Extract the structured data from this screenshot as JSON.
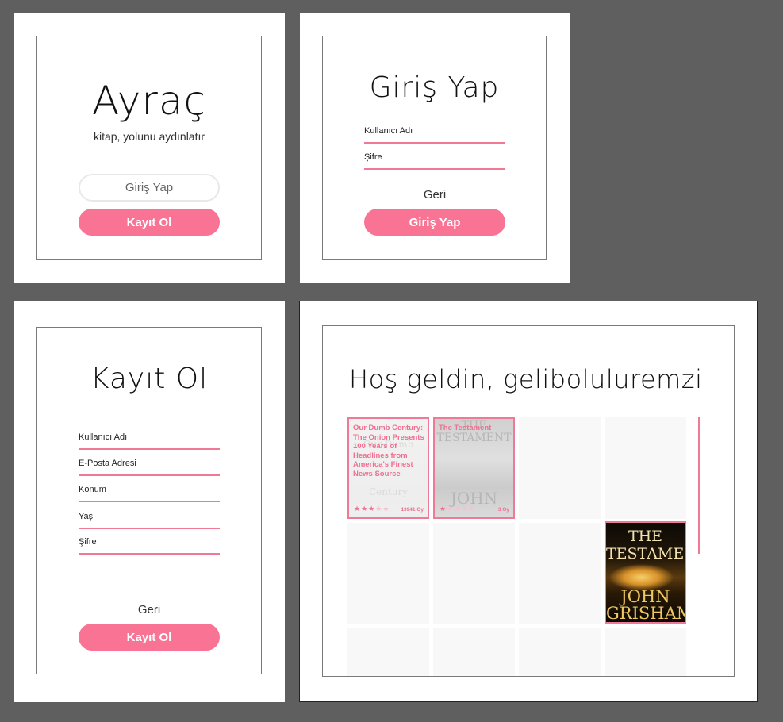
{
  "welcome": {
    "app_name": "Ayraç",
    "tagline": "kitap, yolunu aydınlatır",
    "login_label": "Giriş Yap",
    "register_label": "Kayıt Ol"
  },
  "login": {
    "title": "Giriş Yap",
    "username_label": "Kullanıcı Adı",
    "password_label": "Şifre",
    "back_label": "Geri",
    "submit_label": "Giriş Yap"
  },
  "register": {
    "title": "Kayıt Ol",
    "fields": [
      "Kullanıcı Adı",
      "E-Posta Adresi",
      "Konum",
      "Yaş",
      "Şifre"
    ],
    "back_label": "Geri",
    "submit_label": "Kayıt Ol"
  },
  "home": {
    "greeting": "Hoş geldin, gelibolu​luremzi",
    "books": [
      {
        "title": "Our Dumb Century: The Onion Presents 100 Years of Headlines from America's Finest News Source",
        "rating": 3,
        "votes": "13941 Oy"
      },
      {
        "title": "The Testament",
        "rating": 1,
        "votes": "3 Oy"
      }
    ],
    "featured_cover": {
      "title_line1": "THE",
      "title_line2": "TESTAMENT",
      "author_line1": "JOHN",
      "author_line2": "GRISHAM"
    },
    "ghost_covers": [
      {
        "top": "Our Dumb",
        "bottom": "Century"
      },
      {
        "top": "THE",
        "middle": "TESTAMENT",
        "bottom": "JOHN"
      }
    ]
  },
  "colors": {
    "accent": "#f87394",
    "background": "#5f5f5f",
    "rating_star": "#ef6f8f",
    "star_empty": "#f5c2cf"
  }
}
